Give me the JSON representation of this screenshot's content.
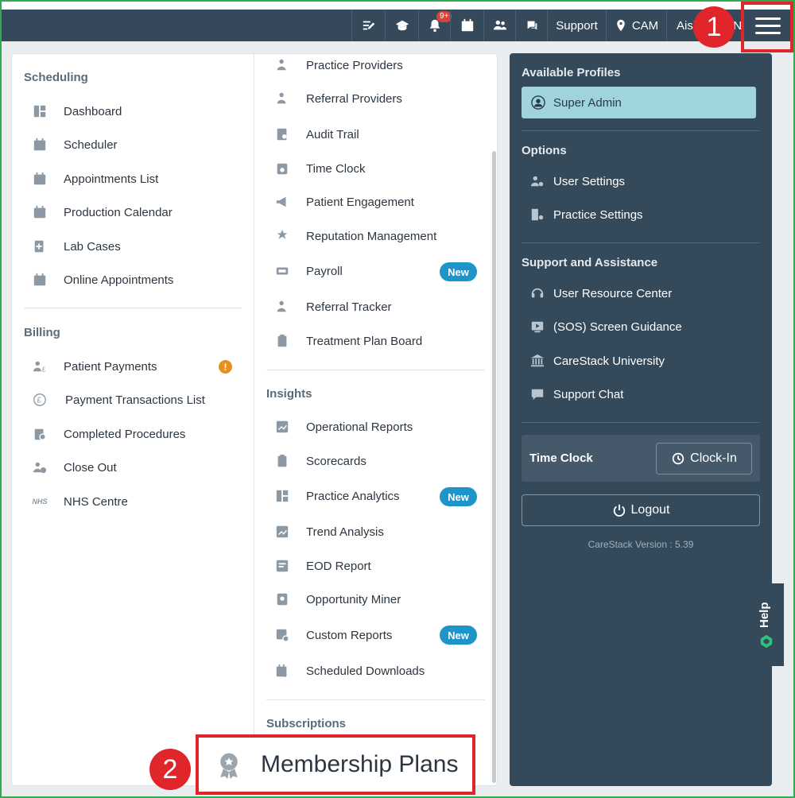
{
  "topbar": {
    "support_label": "Support",
    "location_label": "CAM",
    "user_label": "Aish",
    "user_suffix": "N",
    "notification_count": "9+"
  },
  "scheduling": {
    "title": "Scheduling",
    "items": [
      {
        "label": "Dashboard",
        "icon": "dashboard-icon"
      },
      {
        "label": "Scheduler",
        "icon": "calendar-icon"
      },
      {
        "label": "Appointments List",
        "icon": "appointments-list-icon"
      },
      {
        "label": "Production Calendar",
        "icon": "production-calendar-icon"
      },
      {
        "label": "Lab Cases",
        "icon": "lab-cases-icon"
      },
      {
        "label": "Online Appointments",
        "icon": "online-appointments-icon"
      }
    ]
  },
  "billing": {
    "title": "Billing",
    "items": [
      {
        "label": "Patient Payments",
        "icon": "patient-payments-icon",
        "alert": "!"
      },
      {
        "label": "Payment Transactions List",
        "icon": "pound-icon"
      },
      {
        "label": "Completed Procedures",
        "icon": "completed-procedures-icon"
      },
      {
        "label": "Close Out",
        "icon": "close-out-icon"
      },
      {
        "label": "NHS Centre",
        "icon": "nhs-icon",
        "icon_text": "NHS"
      }
    ]
  },
  "middle": {
    "items": [
      {
        "label": "Practice Providers",
        "icon": "providers-icon"
      },
      {
        "label": "Referral Providers",
        "icon": "referral-providers-icon"
      },
      {
        "label": "Audit Trail",
        "icon": "audit-trail-icon"
      },
      {
        "label": "Time Clock",
        "icon": "time-clock-icon"
      },
      {
        "label": "Patient Engagement",
        "icon": "megaphone-icon"
      },
      {
        "label": "Reputation Management",
        "icon": "reputation-icon"
      },
      {
        "label": "Payroll",
        "icon": "payroll-icon",
        "badge": "New"
      },
      {
        "label": "Referral Tracker",
        "icon": "referral-tracker-icon"
      },
      {
        "label": "Treatment Plan Board",
        "icon": "clipboard-icon"
      }
    ],
    "insights_title": "Insights",
    "insights": [
      {
        "label": "Operational Reports",
        "icon": "chart-icon"
      },
      {
        "label": "Scorecards",
        "icon": "scorecard-icon"
      },
      {
        "label": "Practice Analytics",
        "icon": "analytics-icon",
        "badge": "New"
      },
      {
        "label": "Trend Analysis",
        "icon": "trend-icon"
      },
      {
        "label": "EOD Report",
        "icon": "report-icon"
      },
      {
        "label": "Opportunity Miner",
        "icon": "opportunity-icon"
      },
      {
        "label": "Custom Reports",
        "icon": "custom-reports-icon",
        "badge": "New"
      },
      {
        "label": "Scheduled Downloads",
        "icon": "scheduled-downloads-icon"
      }
    ],
    "subscriptions_title": "Subscriptions",
    "membership_label": "Membership Plans"
  },
  "profiles": {
    "title": "Available Profiles",
    "current": "Super Admin"
  },
  "options": {
    "title": "Options",
    "items": [
      {
        "label": "User Settings",
        "icon": "user-settings-icon"
      },
      {
        "label": "Practice Settings",
        "icon": "practice-settings-icon"
      }
    ]
  },
  "support": {
    "title": "Support and Assistance",
    "items": [
      {
        "label": "User Resource Center",
        "icon": "headset-icon"
      },
      {
        "label": "(SOS) Screen Guidance",
        "icon": "screen-guidance-icon"
      },
      {
        "label": "CareStack University",
        "icon": "university-icon"
      },
      {
        "label": "Support Chat",
        "icon": "chat-icon"
      }
    ]
  },
  "timeclock": {
    "title": "Time Clock",
    "clockin_label": "Clock-In"
  },
  "logout_label": "Logout",
  "version": "CareStack Version : 5.39",
  "help_label": "Help",
  "annotations": {
    "one": "1",
    "two": "2"
  },
  "colors": {
    "accent": "#1e95c9",
    "panel": "#34495a",
    "highlight": "#e0262a"
  }
}
